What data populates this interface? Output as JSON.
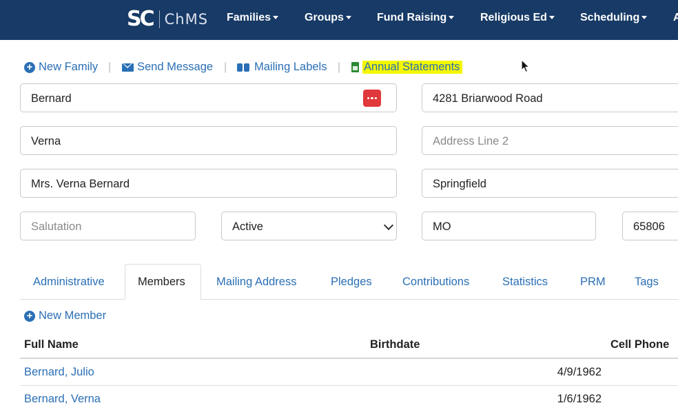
{
  "brand": {
    "logo_mark": "SC",
    "name": "ChMS"
  },
  "nav": {
    "items": [
      {
        "label": "Families"
      },
      {
        "label": "Groups"
      },
      {
        "label": "Fund Raising"
      },
      {
        "label": "Religious Ed"
      },
      {
        "label": "Scheduling"
      },
      {
        "label": "A"
      }
    ]
  },
  "actions": {
    "new_family": "New Family",
    "send_message": "Send Message",
    "mailing_labels": "Mailing Labels",
    "annual_statements": "Annual Statements",
    "separator": "|"
  },
  "form": {
    "last_name": "Bernard",
    "first_name": "Verna",
    "display_name": "Mrs. Verna Bernard",
    "salutation_placeholder": "Salutation",
    "status": "Active",
    "address1": "4281 Briarwood Road",
    "address2_placeholder": "Address Line 2",
    "city": "Springfield",
    "state": "MO",
    "zip": "65806"
  },
  "tabs": [
    {
      "label": "Administrative"
    },
    {
      "label": "Members",
      "active": true
    },
    {
      "label": "Mailing Address"
    },
    {
      "label": "Pledges"
    },
    {
      "label": "Contributions"
    },
    {
      "label": "Statistics"
    },
    {
      "label": "PRM"
    },
    {
      "label": "Tags"
    }
  ],
  "members": {
    "new_member": "New Member",
    "columns": [
      "Full Name",
      "Birthdate",
      "Cell Phone"
    ],
    "rows": [
      {
        "name": "Bernard, Julio",
        "birthdate": "4/9/1962"
      },
      {
        "name": "Bernard, Verna",
        "birthdate": "1/6/1962"
      }
    ]
  },
  "colors": {
    "navbar": "#173a66",
    "link": "#2a6fb5",
    "highlight": "#f4f700",
    "danger": "#e0383b"
  }
}
